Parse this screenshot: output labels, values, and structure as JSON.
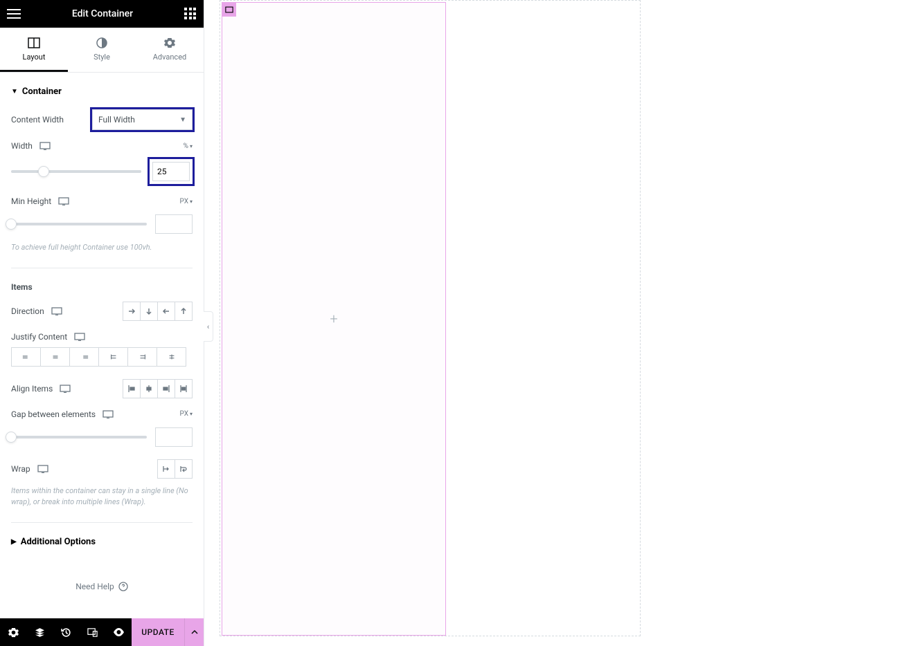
{
  "header": {
    "title": "Edit Container"
  },
  "tabs": {
    "layout": "Layout",
    "style": "Style",
    "advanced": "Advanced"
  },
  "sections": {
    "container": {
      "title": "Container",
      "contentWidth": {
        "label": "Content Width",
        "value": "Full Width"
      },
      "width": {
        "label": "Width",
        "unit": "%",
        "value": "25"
      },
      "minHeight": {
        "label": "Min Height",
        "unit": "PX",
        "value": "",
        "hint": "To achieve full height Container use 100vh."
      }
    },
    "items": {
      "title": "Items",
      "direction": {
        "label": "Direction"
      },
      "justifyContent": {
        "label": "Justify Content"
      },
      "alignItems": {
        "label": "Align Items"
      },
      "gap": {
        "label": "Gap between elements",
        "unit": "PX",
        "value": ""
      },
      "wrap": {
        "label": "Wrap",
        "hint": "Items within the container can stay in a single line (No wrap), or break into multiple lines (Wrap)."
      }
    },
    "additional": {
      "title": "Additional Options"
    }
  },
  "needHelp": "Need Help",
  "footer": {
    "update": "UPDATE"
  }
}
